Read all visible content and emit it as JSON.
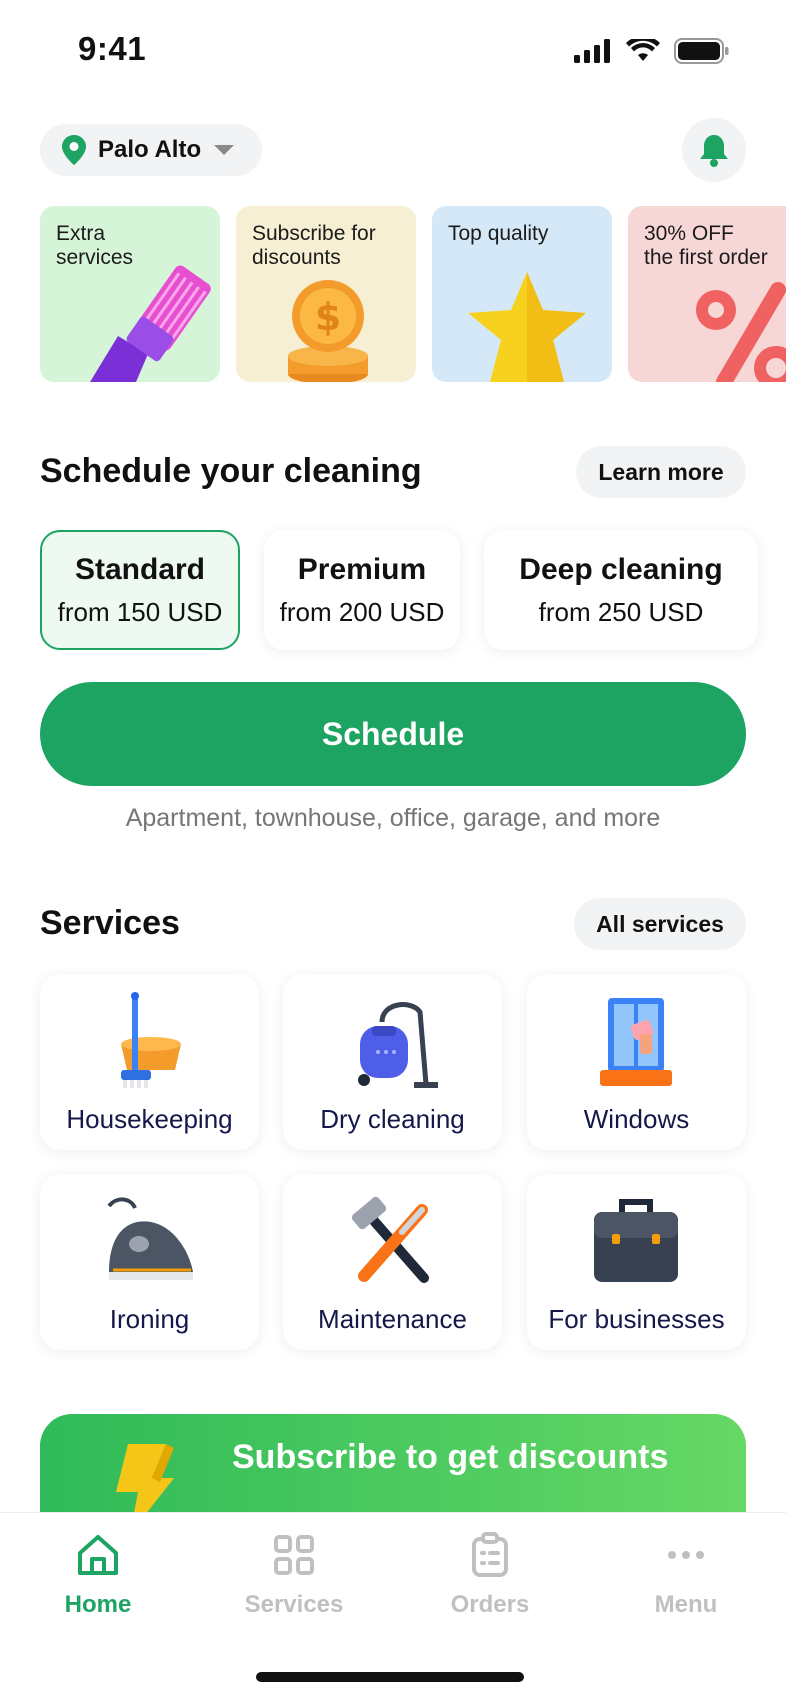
{
  "status_bar": {
    "time": "9:41"
  },
  "header": {
    "location": "Palo Alto"
  },
  "promos": [
    {
      "title": "Extra\nservices",
      "bg": "#d6f5d8",
      "icon": "brush-icon"
    },
    {
      "title": "Subscribe for\ndiscounts",
      "bg": "#f7efd4",
      "icon": "coin-icon"
    },
    {
      "title": "Top quality",
      "bg": "#d4e8f7",
      "icon": "star-icon"
    },
    {
      "title": "30% OFF\nthe first order",
      "bg": "#f7d6d6",
      "icon": "percent-icon"
    }
  ],
  "schedule": {
    "title": "Schedule your cleaning",
    "learn_more": "Learn more",
    "plans": [
      {
        "name": "Standard",
        "price": "from 150 USD",
        "selected": true
      },
      {
        "name": "Premium",
        "price": "from 200 USD",
        "selected": false
      },
      {
        "name": "Deep cleaning",
        "price": "from 250 USD",
        "selected": false
      }
    ],
    "button": "Schedule",
    "caption": "Apartment, townhouse, office, garage, and more"
  },
  "services": {
    "title": "Services",
    "all_button": "All services",
    "items": [
      {
        "label": "Housekeeping",
        "icon": "mop-bucket-icon"
      },
      {
        "label": "Dry cleaning",
        "icon": "vacuum-cleaner-icon"
      },
      {
        "label": "Windows",
        "icon": "window-cleaning-icon"
      },
      {
        "label": "Ironing",
        "icon": "iron-icon"
      },
      {
        "label": "Maintenance",
        "icon": "hammer-screwdriver-icon"
      },
      {
        "label": "For businesses",
        "icon": "briefcase-icon"
      }
    ]
  },
  "subscribe_banner": {
    "label": "Subscribe to get discounts",
    "icon": "lightning-icon"
  },
  "tabs": [
    {
      "label": "Home",
      "icon": "home-icon",
      "active": true
    },
    {
      "label": "Services",
      "icon": "grid-icon",
      "active": false
    },
    {
      "label": "Orders",
      "icon": "clipboard-icon",
      "active": false
    },
    {
      "label": "Menu",
      "icon": "more-dots-icon",
      "active": false
    }
  ],
  "colors": {
    "accent": "#1da462",
    "inactive_tab": "#c0c0c0",
    "text_dark": "#111111",
    "caption_gray": "#767676"
  }
}
